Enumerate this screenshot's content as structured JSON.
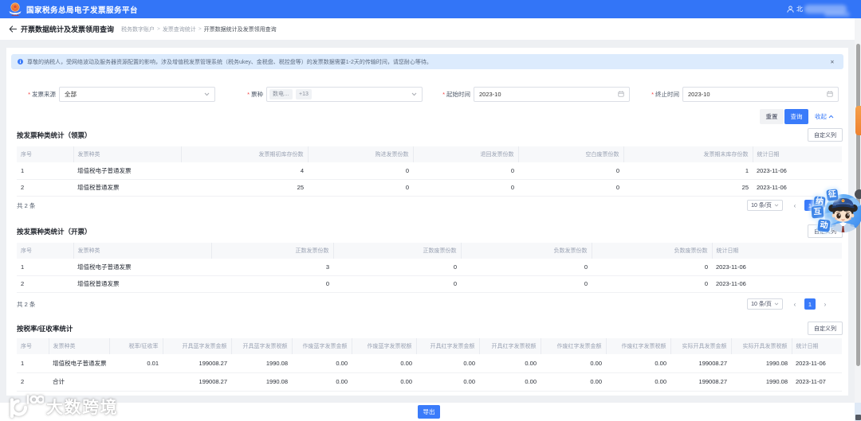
{
  "navbar": {
    "brand": "国家税务总局电子发票服务平台",
    "user_prefix": "北"
  },
  "titlebar": {
    "back": "←",
    "title": "开票数据统计及发票领用查询",
    "breadcrumb": [
      "税务数字账户",
      "发票查询统计",
      "开票数据统计及发票领用查询"
    ],
    "separator": ">"
  },
  "notice": {
    "text": "尊敬的纳税人，受网络波动及服务器资源配置的影响，涉及增值税发票管理系统（税务ukey、金税盘、税控盘等）的发票数据需要1-2天的传输时间，请您耐心等待。",
    "close": "✕"
  },
  "filters": {
    "fields": [
      {
        "label": "发票来源",
        "value": "全部"
      },
      {
        "label": "票种",
        "tags": [
          "数电…",
          "+13"
        ]
      },
      {
        "label": "起始时间",
        "value": "2023-10"
      },
      {
        "label": "终止时间",
        "value": "2023-10"
      }
    ],
    "required_marker": "*",
    "reset_label": "重置",
    "query_label": "查询",
    "collapse_label": "收起"
  },
  "sections": [
    {
      "title": "按发票种类统计（领票）",
      "customize_label": "自定义列",
      "columns": [
        "序号",
        "发票种类",
        "发票期初库存份数",
        "购进发票份数",
        "退回发票份数",
        "空白废票份数",
        "发票期末库存份数",
        "统计日期"
      ],
      "rows": [
        [
          "1",
          "增值税电子普通发票",
          "4",
          "0",
          "0",
          "0",
          "1",
          "2023-11-06"
        ],
        [
          "2",
          "增值税普通发票",
          "25",
          "0",
          "0",
          "0",
          "25",
          "2023-11-06"
        ]
      ],
      "total_text": "共 2 条",
      "page_size": "10 条/页",
      "prev": "‹",
      "page": "1",
      "next": "›"
    },
    {
      "title": "按发票种类统计（开票）",
      "customize_label": "自定义列",
      "columns": [
        "序号",
        "发票种类",
        "正数发票份数",
        "正数废票份数",
        "负数发票份数",
        "负数废票份数",
        "统计日期"
      ],
      "rows": [
        [
          "1",
          "增值税电子普通发票",
          "3",
          "0",
          "0",
          "0",
          "2023-11-06"
        ],
        [
          "2",
          "增值税普通发票",
          "0",
          "0",
          "0",
          "0",
          "2023-11-06"
        ]
      ],
      "total_text": "共 2 条",
      "page_size": "10 条/页",
      "prev": "‹",
      "page": "1",
      "next": "›"
    },
    {
      "title": "按税率/征收率统计",
      "customize_label": "自定义列",
      "columns": [
        "序号",
        "发票种类",
        "税率/征收率",
        "开具蓝字发票金额",
        "开具蓝字发票税额",
        "作废蓝字发票金额",
        "作废蓝字发票税额",
        "开具红字发票金额",
        "开具红字发票税额",
        "作废红字发票金额",
        "作废红字发票税额",
        "实际开具发票金额",
        "实际开具发票税额",
        "统计日期"
      ],
      "rows": [
        [
          "1",
          "增值税电子普通发票",
          "0.01",
          "199008.27",
          "1990.08",
          "0.00",
          "0.00",
          "0.00",
          "0.00",
          "0.00",
          "0.00",
          "199008.27",
          "1990.08",
          "2023-11-06"
        ],
        [
          "2",
          "合计",
          "",
          "199008.27",
          "1990.08",
          "0.00",
          "0.00",
          "0.00",
          "0.00",
          "0.00",
          "0.00",
          "199008.27",
          "1990.08",
          "2023-11-07"
        ]
      ]
    }
  ],
  "footer": {
    "export_label": "导出"
  },
  "floating_widget": {
    "chars": [
      "征",
      "纳",
      "互",
      "动"
    ]
  },
  "watermark": {
    "text": "大数跨境"
  },
  "colors": {
    "primary": "#3a7bfa",
    "navbar": "#3375f7",
    "notice_bg": "#dcebfd",
    "page_bg": "#eef0f3"
  }
}
